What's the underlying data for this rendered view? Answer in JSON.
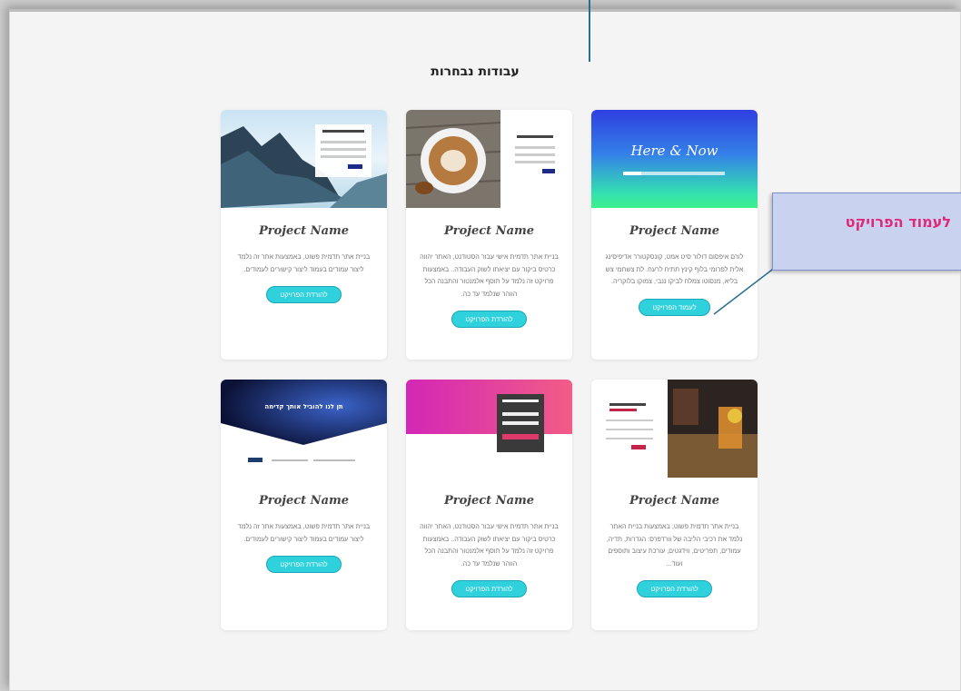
{
  "section_title": "עבודות נבחרות",
  "callout": {
    "label": "לעמוד הפרויקט"
  },
  "cards": [
    {
      "thumbnail": "mountain-form-thumbnail",
      "name": "Project Name",
      "description": "בניית אתר תדמית פשוט, באמצעות אתר זה נלמד ליצור עמודים בעמוד ליצור קישורים לעמודים.",
      "button": "להורדת הפרויקט"
    },
    {
      "thumbnail": "coffee-form-thumbnail",
      "name": "Project Name",
      "description": "בניית אתר תדמית אישי עבור הסטודנט, האתר יהווה כרטיס ביקור עם יציאתו לשוק העבודה.. באמצעות פרויקט זה נלמד על תוסף אלמנטור והתבנה הכל הווהר שנלמד עד כה.",
      "button": "להורדת הפרויקט"
    },
    {
      "thumbnail": "here-and-now-thumbnail",
      "thumb_text": "Here & Now",
      "name": "Project Name",
      "description": "לורם איפסום דולור סיט אמט, קונסקטורר אדיפיסינג אלית לפרומי בלוף קינץ תתיח לרעח. לת צשחמי צש בליא, מנסוטו צמלח לביקו ננבי, צמוקו בלוקריה.",
      "button": "לעמוד הפרויקט"
    },
    {
      "thumbnail": "dark-landing-thumbnail",
      "thumb_text": "תן לנו להוביל אותך קדימה",
      "name": "Project Name",
      "description": "בניית אתר תדמית פשוט, באמצעות אתר זה נלמד ליצור עמודים בעמוד ליצור קישורים לעמודים.",
      "button": "להורדת הפרויקט"
    },
    {
      "thumbnail": "pink-form-thumbnail",
      "name": "Project Name",
      "description": "בניית אתר תדמית אישי עבור הסטודנט, האתר יהווה כרטיס ביקור עם יציאתו לשוק העבודה.. באמצעות פרויקט זה נלמד על תוסף אלמנטור והתבנה הכל הווהר שנלמד עד כה.",
      "button": "להורדת הפרויקט"
    },
    {
      "thumbnail": "bar-photo-thumbnail",
      "name": "Project Name",
      "description": "בניית אתר תדמית פשוט, באמצעות בניית האתר נלמד את רכיבי הליבה של וורדפרס: הגדרות, תדיה, עמודים, תפריטים, ווידגטים, עורכת עיצוב ותוספים ועוד...",
      "button": "להורדת הפרויקט"
    }
  ],
  "colors": {
    "button": "#2fd2dc",
    "callout_bg": "#c9d2ef",
    "callout_text": "#e0287a",
    "pointer_line": "#2a6f8f"
  }
}
